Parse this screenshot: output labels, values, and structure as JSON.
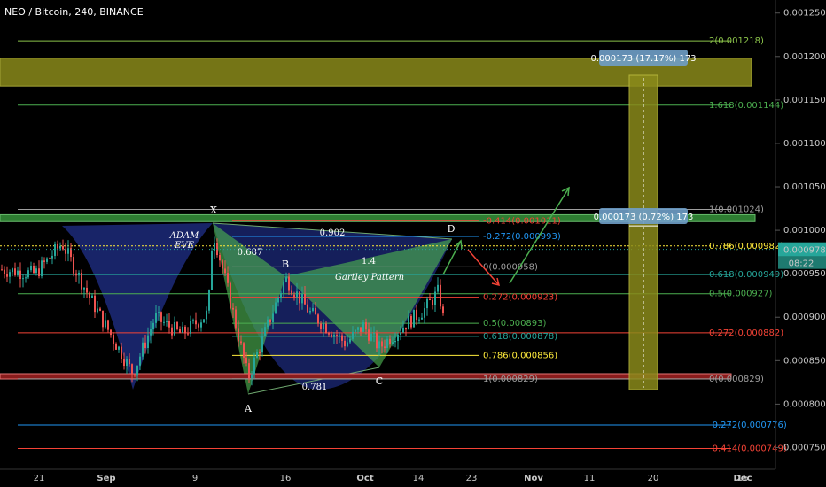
{
  "chart_data": {
    "type": "candlestick",
    "title": "NEO / Bitcoin, 240, BINANCE",
    "y_ticks": [
      "0.001250",
      "0.001200",
      "0.001150",
      "0.001100",
      "0.001050",
      "0.001000",
      "0.000950",
      "0.000900",
      "0.000850",
      "0.000800",
      "0.000750"
    ],
    "x_ticks": [
      "21",
      "Sep",
      "9",
      "16",
      "Oct",
      "14",
      "23",
      "Nov",
      "11",
      "20",
      "Dec",
      "16"
    ],
    "last_price": "0.000978",
    "countdown": "08:22",
    "fib_levels_right": [
      {
        "label": "2(0.001218)",
        "value": 0.001218,
        "color": "#8bc34a"
      },
      {
        "label": "1.618(0.001144)",
        "value": 0.001144,
        "color": "#4caf50"
      },
      {
        "label": "1(0.001024)",
        "value": 0.001024,
        "color": "#9e9e9e"
      },
      {
        "label": "0.786(0.000982)",
        "value": 0.000982,
        "color": "#ffeb3b"
      },
      {
        "label": "0.618(0.000949)",
        "value": 0.000949,
        "color": "#26a69a"
      },
      {
        "label": "0.5(0.000927)",
        "value": 0.000927,
        "color": "#4caf50"
      },
      {
        "label": "0.272(0.000882)",
        "value": 0.000882,
        "color": "#f44336"
      },
      {
        "label": "0(0.000829)",
        "value": 0.000829,
        "color": "#9e9e9e"
      },
      {
        "label": "-0.272(0.000776)",
        "value": 0.000776,
        "color": "#2196f3"
      },
      {
        "label": "-0.414(0.000749)",
        "value": 0.000749,
        "color": "#f44336"
      }
    ],
    "fib_levels_mid": [
      {
        "label": "-0.414(0.001011)",
        "value": 0.001011,
        "color": "#f44336"
      },
      {
        "label": "-0.272(0.000993)",
        "value": 0.000993,
        "color": "#2196f3"
      },
      {
        "label": "0(0.000958)",
        "value": 0.000958,
        "color": "#9e9e9e"
      },
      {
        "label": "0.272(0.000923)",
        "value": 0.000923,
        "color": "#f44336"
      },
      {
        "label": "0.5(0.000893)",
        "value": 0.000893,
        "color": "#4caf50"
      },
      {
        "label": "0.618(0.000878)",
        "value": 0.000878,
        "color": "#26a69a"
      },
      {
        "label": "0.786(0.000856)",
        "value": 0.000856,
        "color": "#ffeb3b"
      },
      {
        "label": "1(0.000829)",
        "value": 0.000829,
        "color": "#9e9e9e"
      }
    ],
    "pattern_points": [
      "X",
      "A",
      "B",
      "C",
      "D"
    ],
    "pattern_ratios": [
      "0.687",
      "0.902",
      "1.4",
      "0.781"
    ],
    "annotations": [
      "ADAM EVE",
      "Gartley Pattern"
    ],
    "measure_boxes": [
      "0.000173 (17.17%) 173",
      "0.000173 (0.72%) 173"
    ],
    "resistance_zone": [
      0.001166,
      0.001198
    ],
    "support_zone": [
      0.000826,
      0.000833
    ],
    "ylim": [
      0.000725,
      0.001265
    ]
  },
  "colors": {
    "background": "#000000",
    "price_axis_bg": "#000000",
    "last_price_tag": "#26a69a",
    "zone_olive": "#8a8a1a",
    "pattern_blue": "#1c2a7a",
    "pattern_green": "#4caf50",
    "candle_up": "#26a69a",
    "candle_down": "#ef5350"
  }
}
